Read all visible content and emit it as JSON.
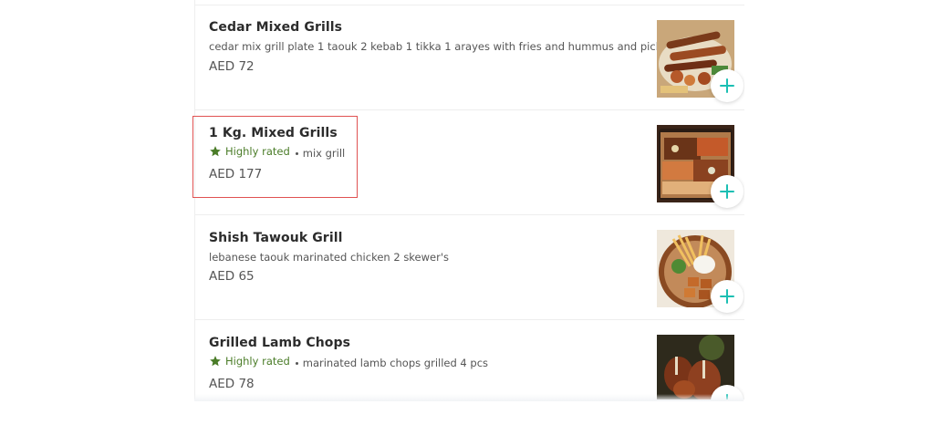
{
  "menu": {
    "items": [
      {
        "name": "Cedar Mixed Grills",
        "description": "cedar mix grill plate 1 taouk 2 kebab 1 tikka 1 arayes with fries and hummus and pickles",
        "price": "AED 72",
        "image": "mixed-grill-platter"
      },
      {
        "name": "1 Kg. Mixed Grills",
        "rating": "Highly rated",
        "description": "mix grill",
        "price": "AED 177",
        "image": "kilo-mixed-grill-tray"
      },
      {
        "name": "Shish Tawouk Grill",
        "description": "lebanese taouk marinated chicken 2 skewer's",
        "price": "AED 65",
        "image": "shish-tawouk-plate"
      },
      {
        "name": "Grilled Lamb Chops",
        "rating": "Highly rated",
        "description": "marinated lamb chops grilled 4 pcs",
        "price": "AED 78",
        "image": "lamb-chops"
      }
    ]
  },
  "colors": {
    "accent": "#1bbfb3",
    "rating_green": "#4a7c28",
    "highlight": "#e05252"
  }
}
